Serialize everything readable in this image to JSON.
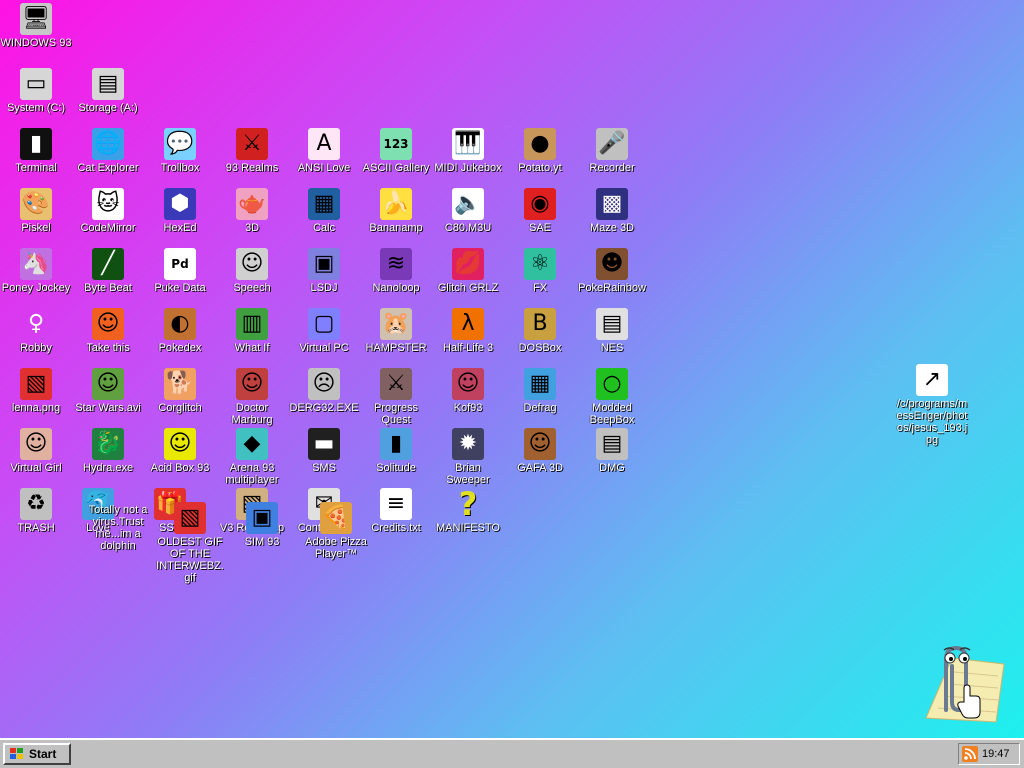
{
  "desktop": {
    "icons": [
      {
        "label": "WINDOWS 93",
        "icon": "computer-icon",
        "glyph": "🖥",
        "bg": "#c8c8c8"
      },
      {
        "label": "System (C:)",
        "icon": "hard-drive-icon",
        "glyph": "▭",
        "bg": "#d6d6d6"
      },
      {
        "label": "Storage (A:)",
        "icon": "floppy-drive-icon",
        "glyph": "▤",
        "bg": "#d6d6d6"
      },
      {
        "label": "Terminal",
        "icon": "terminal-icon",
        "glyph": "▮",
        "bg": "#101010"
      },
      {
        "label": "Cat Explorer",
        "icon": "globe-icon",
        "glyph": "🌐",
        "bg": "#3aa0e8"
      },
      {
        "label": "Trollbox",
        "icon": "chat-bubble-icon",
        "glyph": "💬",
        "bg": "#7ad0ff"
      },
      {
        "label": "93 Realms",
        "icon": "sword-knight-icon",
        "glyph": "⚔",
        "bg": "#d02020"
      },
      {
        "label": "ANSI Love",
        "icon": "letter-a-icon",
        "glyph": "A",
        "bg": "#ffe6f6"
      },
      {
        "label": "ASCII Gallery",
        "icon": "numbers-icon",
        "glyph": "123",
        "bg": "#7ee0b0"
      },
      {
        "label": "MIDI Jukebox",
        "icon": "piano-keys-icon",
        "glyph": "🎹",
        "bg": "#ffffff"
      },
      {
        "label": "Potato.yt",
        "icon": "potato-icon",
        "glyph": "●",
        "bg": "#c8955a"
      },
      {
        "label": "Recorder",
        "icon": "microphone-icon",
        "glyph": "🎤",
        "bg": "#c0c0c0"
      },
      {
        "label": "Piskel",
        "icon": "paint-palette-icon",
        "glyph": "🎨",
        "bg": "#e8c070"
      },
      {
        "label": "CodeMirror",
        "icon": "cat-head-icon",
        "glyph": "🐱",
        "bg": "#ffffff"
      },
      {
        "label": "HexEd",
        "icon": "blue-cube-icon",
        "glyph": "⬢",
        "bg": "#3a3ab8"
      },
      {
        "label": "3D",
        "icon": "teapot-icon",
        "glyph": "🫖",
        "bg": "#f0a0c0"
      },
      {
        "label": "Calc",
        "icon": "calculator-icon",
        "glyph": "▦",
        "bg": "#2060a0"
      },
      {
        "label": "Bananamp",
        "icon": "banana-icon",
        "glyph": "🍌",
        "bg": "#ffe040"
      },
      {
        "label": "C80.M3U",
        "icon": "speaker-file-icon",
        "glyph": "🔈",
        "bg": "#ffffff"
      },
      {
        "label": "SAE",
        "icon": "checkered-ball-icon",
        "glyph": "◉",
        "bg": "#e02020"
      },
      {
        "label": "Maze 3D",
        "icon": "maze-icon",
        "glyph": "▩",
        "bg": "#303080"
      },
      {
        "label": "Poney Jockey",
        "icon": "pony-icon",
        "glyph": "🦄",
        "bg": "#c070e0"
      },
      {
        "label": "Byte Beat",
        "icon": "green-wave-icon",
        "glyph": "╱",
        "bg": "#105010"
      },
      {
        "label": "Puke Data",
        "icon": "pd-document-icon",
        "glyph": "Pd",
        "bg": "#ffffff"
      },
      {
        "label": "Speech",
        "icon": "talking-head-icon",
        "glyph": "☺",
        "bg": "#d0d0d0"
      },
      {
        "label": "LSDJ",
        "icon": "gameboy-icon",
        "glyph": "▣",
        "bg": "#8080e0"
      },
      {
        "label": "Nanoloop",
        "icon": "waveform-icon",
        "glyph": "≋",
        "bg": "#7a3ab8"
      },
      {
        "label": "Glitch GRLZ",
        "icon": "lips-icon",
        "glyph": "💋",
        "bg": "#e02060"
      },
      {
        "label": "FX",
        "icon": "atom-icon",
        "glyph": "⚛",
        "bg": "#30c0a0"
      },
      {
        "label": "PokeRainbow",
        "icon": "trainers-icon",
        "glyph": "☻",
        "bg": "#805030"
      },
      {
        "label": "Robby",
        "icon": "stick-figure-icon",
        "glyph": "♀",
        "bg": "transparent"
      },
      {
        "label": "Take this",
        "icon": "old-man-icon",
        "glyph": "☺",
        "bg": "#f06020"
      },
      {
        "label": "Pokedex",
        "icon": "pokeball-icon",
        "glyph": "◐",
        "bg": "#c07030"
      },
      {
        "label": "What If",
        "icon": "film-strip-icon",
        "glyph": "▥",
        "bg": "#40a040"
      },
      {
        "label": "Virtual PC",
        "icon": "window-pc-icon",
        "glyph": "▢",
        "bg": "#8080ff"
      },
      {
        "label": "HAMPSTER",
        "icon": "hamster-icon",
        "glyph": "🐹",
        "bg": "#d0c0b0"
      },
      {
        "label": "Half-Life 3",
        "icon": "lambda-icon",
        "glyph": "λ",
        "bg": "#f07000"
      },
      {
        "label": "DOSBox",
        "icon": "dos-box-icon",
        "glyph": "B",
        "bg": "#c8a040"
      },
      {
        "label": "NES",
        "icon": "console-icon",
        "glyph": "▤",
        "bg": "#e0e0e0"
      },
      {
        "label": "lenna.png",
        "icon": "image-file-icon",
        "glyph": "▧",
        "bg": "#e03030"
      },
      {
        "label": "Star Wars.avi",
        "icon": "yoda-icon",
        "glyph": "☺",
        "bg": "#60a040"
      },
      {
        "label": "Corglitch",
        "icon": "corgi-icon",
        "glyph": "🐕",
        "bg": "#f0a060"
      },
      {
        "label": "Doctor Marburg",
        "icon": "doctor-icon",
        "glyph": "☺",
        "bg": "#c04040"
      },
      {
        "label": "DERG32.EXE",
        "icon": "crt-face-icon",
        "glyph": "☹",
        "bg": "#c0c0c0"
      },
      {
        "label": "Progress Quest",
        "icon": "crossed-swords-icon",
        "glyph": "⚔",
        "bg": "#806060"
      },
      {
        "label": "Kof93",
        "icon": "fighter-face-icon",
        "glyph": "☺",
        "bg": "#c04060"
      },
      {
        "label": "Defrag",
        "icon": "defrag-blocks-icon",
        "glyph": "▦",
        "bg": "#40a0e0"
      },
      {
        "label": "Modded BeepBox",
        "icon": "green-ring-icon",
        "glyph": "○",
        "bg": "#20c020"
      },
      {
        "label": "Virtual Girl",
        "icon": "girl-face-icon",
        "glyph": "☺",
        "bg": "#e0b0a0"
      },
      {
        "label": "Hydra.exe",
        "icon": "dragon-icon",
        "glyph": "🐉",
        "bg": "#208040"
      },
      {
        "label": "Acid Box 93",
        "icon": "smiley-icon",
        "glyph": "☺",
        "bg": "#e8e800"
      },
      {
        "label": "Arena 93 multiplayer",
        "icon": "color-cube-icon",
        "glyph": "◆",
        "bg": "#40c0c0"
      },
      {
        "label": "SMS",
        "icon": "cartridge-icon",
        "glyph": "▬",
        "bg": "#202020"
      },
      {
        "label": "Solitude",
        "icon": "lantern-icon",
        "glyph": "▮",
        "bg": "#50a0e0"
      },
      {
        "label": "Brian Sweeper",
        "icon": "mine-icon",
        "glyph": "✹",
        "bg": "#404060"
      },
      {
        "label": "GAFA 3D",
        "icon": "soldier-face-icon",
        "glyph": "☺",
        "bg": "#a06030"
      },
      {
        "label": "DMG",
        "icon": "device-icon",
        "glyph": "▤",
        "bg": "#c0c0c0"
      },
      {
        "label": "TRASH",
        "icon": "recycle-bin-icon",
        "glyph": "♻",
        "bg": "#c0c0c0"
      },
      {
        "label": "Love",
        "icon": "dolphin-icon",
        "glyph": "🐬",
        "bg": "#40a0e0"
      },
      {
        "label": "SSS",
        "icon": "gift-icon",
        "glyph": "🎁",
        "bg": "#e03030"
      },
      {
        "label": "V3 Roadmap",
        "icon": "map-icon",
        "glyph": "▧",
        "bg": "#d0b080"
      },
      {
        "label": "SIM 93",
        "icon": "id-card-icon",
        "glyph": "▣",
        "bg": "#4080e0"
      },
      {
        "label": "Contact us",
        "icon": "mail-icon",
        "glyph": "✉",
        "bg": "#e0e0e0"
      },
      {
        "label": "Adobe Pizza Player™",
        "icon": "pizza-icon",
        "glyph": "🍕",
        "bg": "#e0a040"
      },
      {
        "label": "Credits.txt",
        "icon": "text-file-icon",
        "glyph": "≡",
        "bg": "#ffffff"
      },
      {
        "label": "MANIFESTO",
        "icon": "question-mark-icon",
        "glyph": "?",
        "bg": "transparent"
      },
      {
        "label": "Totally not a virus.Trust me...im a dolphin",
        "icon": "shortcut-dolphin-icon",
        "glyph": "",
        "bg": "transparent"
      },
      {
        "label": "OLDEST GIF OF THE INTERWEBZ.gif",
        "icon": "gif-file-icon",
        "glyph": "▧",
        "bg": "#e03030"
      },
      {
        "label": "/c/programs/messEnger/photos/jesus_193.jpg",
        "icon": "shortcut-file-icon",
        "glyph": "↗",
        "bg": "#ffffff"
      }
    ]
  },
  "taskbar": {
    "start_label": "Start",
    "clock": "19:47",
    "tray_icon": "rss-feed-icon"
  },
  "assistant": {
    "name": "clippy-assistant",
    "icon": "paperclip-icon"
  },
  "colors": {
    "desktop_gradient_start": "#ff12e4",
    "desktop_gradient_end": "#1ef0ee",
    "taskbar": "#c0c0c0"
  }
}
